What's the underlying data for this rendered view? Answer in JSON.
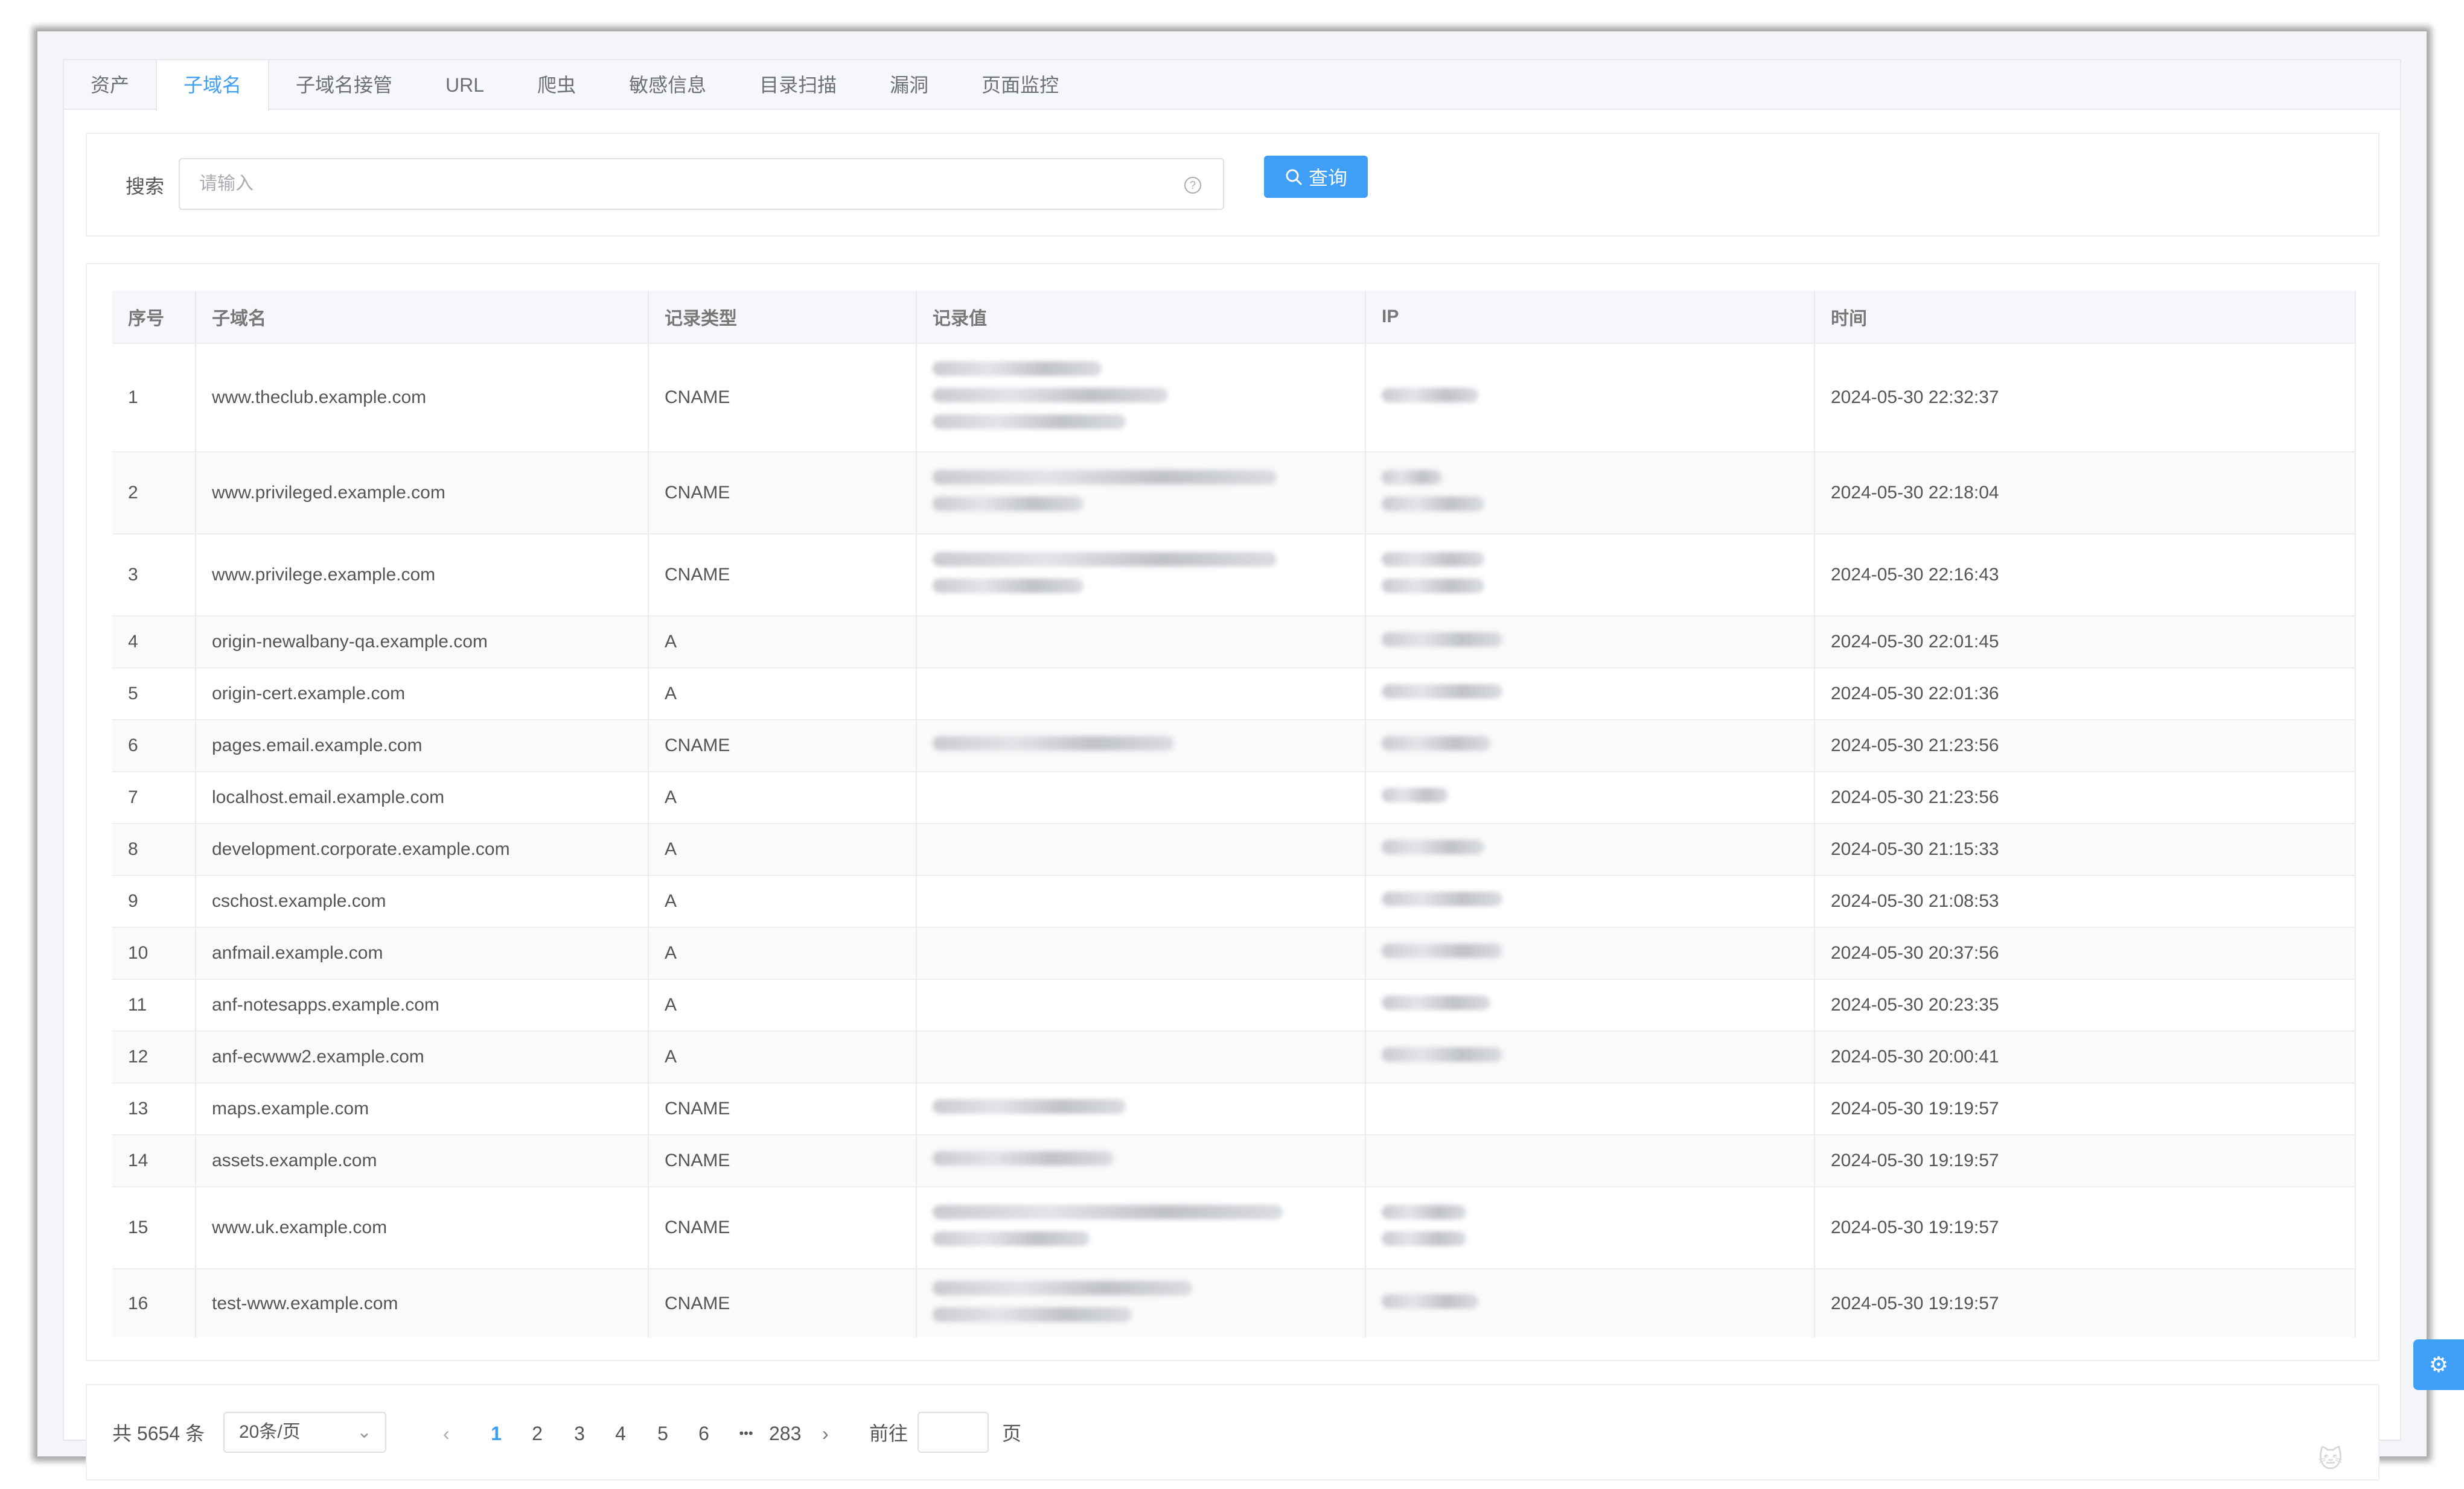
{
  "tabs": [
    {
      "label": "资产",
      "active": false
    },
    {
      "label": "子域名",
      "active": true
    },
    {
      "label": "子域名接管",
      "active": false
    },
    {
      "label": "URL",
      "active": false
    },
    {
      "label": "爬虫",
      "active": false
    },
    {
      "label": "敏感信息",
      "active": false
    },
    {
      "label": "目录扫描",
      "active": false
    },
    {
      "label": "漏洞",
      "active": false
    },
    {
      "label": "页面监控",
      "active": false
    }
  ],
  "search": {
    "label": "搜索",
    "placeholder": "请输入",
    "button_label": "查询"
  },
  "table": {
    "headers": {
      "index": "序号",
      "subdomain": "子域名",
      "record_type": "记录类型",
      "record_value": "记录值",
      "ip": "IP",
      "time": "时间"
    },
    "rows": [
      {
        "index": "1",
        "subdomain": "www.theclub.example.com",
        "type": "CNAME",
        "time": "2024-05-30 22:32:37"
      },
      {
        "index": "2",
        "subdomain": "www.privileged.example.com",
        "type": "CNAME",
        "time": "2024-05-30 22:18:04"
      },
      {
        "index": "3",
        "subdomain": "www.privilege.example.com",
        "type": "CNAME",
        "time": "2024-05-30 22:16:43"
      },
      {
        "index": "4",
        "subdomain": "origin-newalbany-qa.example.com",
        "type": "A",
        "time": "2024-05-30 22:01:45"
      },
      {
        "index": "5",
        "subdomain": "origin-cert.example.com",
        "type": "A",
        "time": "2024-05-30 22:01:36"
      },
      {
        "index": "6",
        "subdomain": "pages.email.example.com",
        "type": "CNAME",
        "time": "2024-05-30 21:23:56"
      },
      {
        "index": "7",
        "subdomain": "localhost.email.example.com",
        "type": "A",
        "time": "2024-05-30 21:23:56"
      },
      {
        "index": "8",
        "subdomain": "development.corporate.example.com",
        "type": "A",
        "time": "2024-05-30 21:15:33"
      },
      {
        "index": "9",
        "subdomain": "cschost.example.com",
        "type": "A",
        "time": "2024-05-30 21:08:53"
      },
      {
        "index": "10",
        "subdomain": "anfmail.example.com",
        "type": "A",
        "time": "2024-05-30 20:37:56"
      },
      {
        "index": "11",
        "subdomain": "anf-notesapps.example.com",
        "type": "A",
        "time": "2024-05-30 20:23:35"
      },
      {
        "index": "12",
        "subdomain": "anf-ecwww2.example.com",
        "type": "A",
        "time": "2024-05-30 20:00:41"
      },
      {
        "index": "13",
        "subdomain": "maps.example.com",
        "type": "CNAME",
        "time": "2024-05-30 19:19:57"
      },
      {
        "index": "14",
        "subdomain": "assets.example.com",
        "type": "CNAME",
        "time": "2024-05-30 19:19:57"
      },
      {
        "index": "15",
        "subdomain": "www.uk.example.com",
        "type": "CNAME",
        "time": "2024-05-30 19:19:57"
      },
      {
        "index": "16",
        "subdomain": "test-www.example.com",
        "type": "CNAME",
        "time": "2024-05-30 19:19:57"
      }
    ]
  },
  "pagination": {
    "total": "共 5654 条",
    "page_size": "20条/页",
    "pages": [
      "1",
      "2",
      "3",
      "4",
      "5",
      "6"
    ],
    "ellipsis": "•••",
    "last_page": "283",
    "goto_label": "前往",
    "page_suffix": "页"
  },
  "colors": {
    "accent": "#3f9ef5"
  }
}
